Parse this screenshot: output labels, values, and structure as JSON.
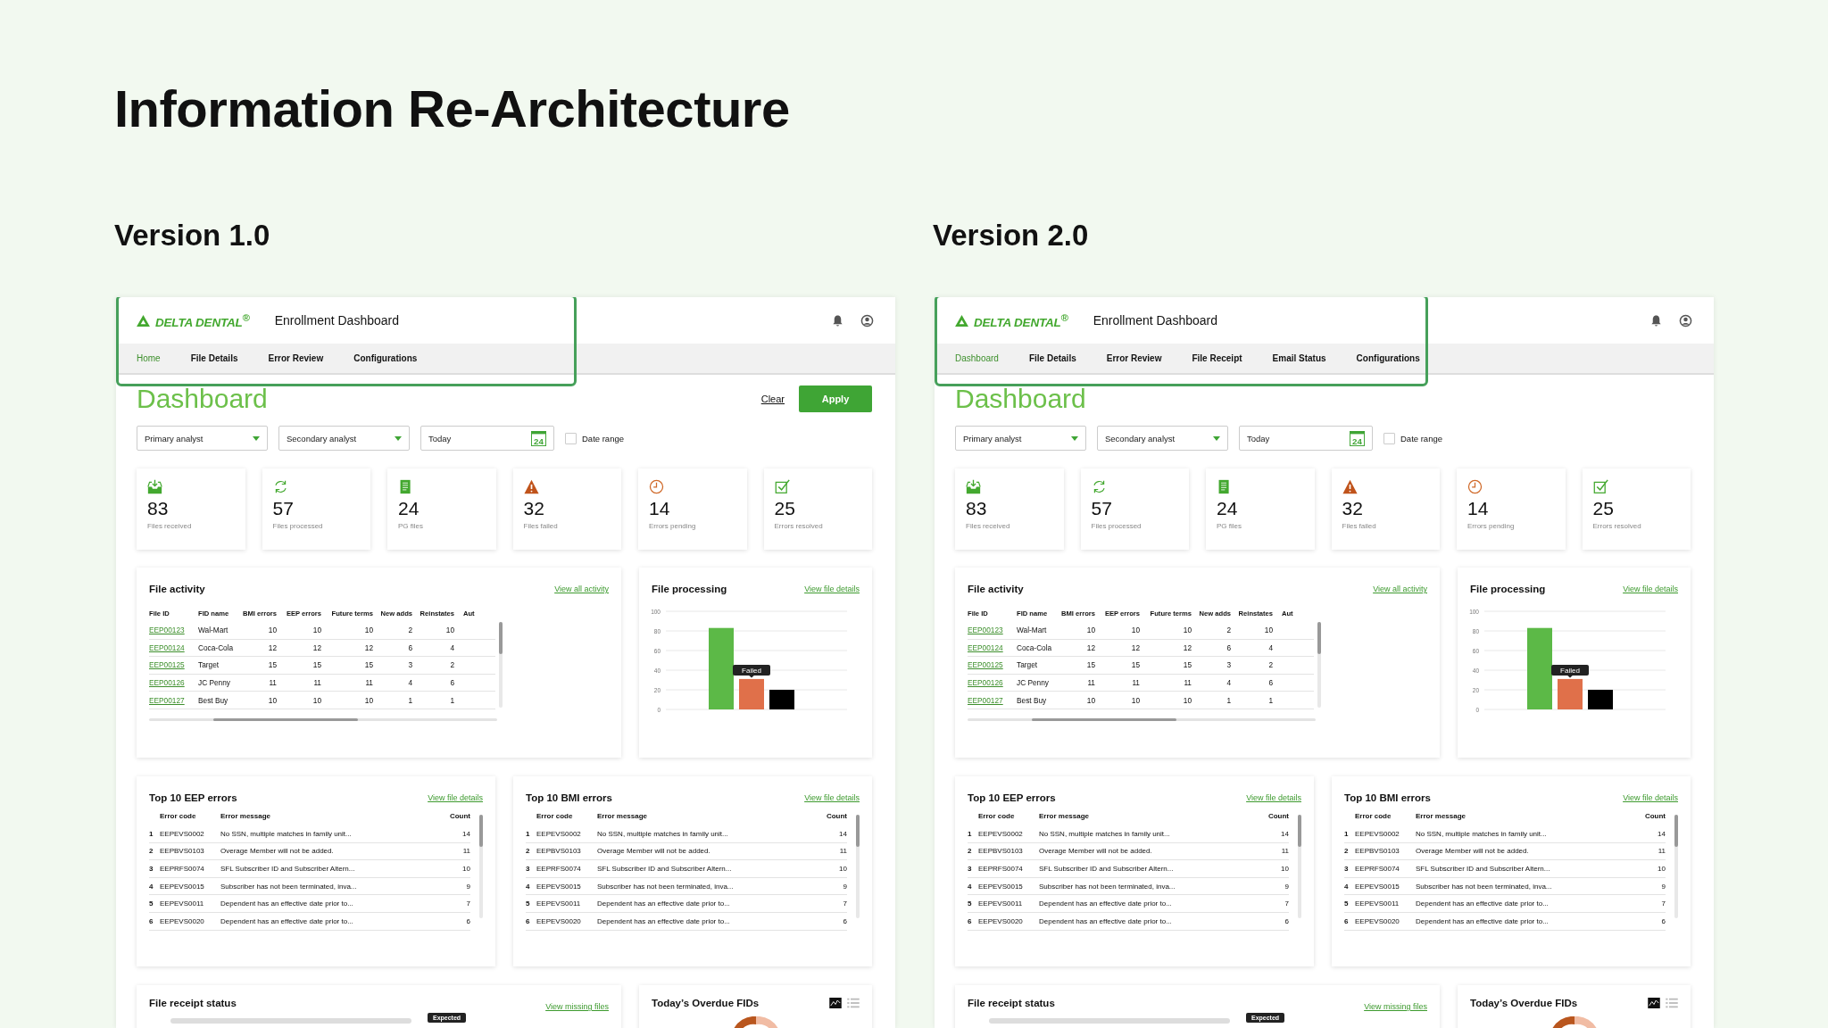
{
  "title": "Information Re-Architecture",
  "versions": [
    {
      "label": "Version 1.0",
      "app": {
        "brand": "DELTA DENTAL$^{®}$",
        "app_title": "Enrollment Dashboard",
        "nav": [
          {
            "label": "Home",
            "selected": true
          },
          {
            "label": "File Details",
            "selected": false
          },
          {
            "label": "Error Review",
            "selected": false
          },
          {
            "label": "Configurations",
            "selected": false
          }
        ],
        "page_title": "Dashboard",
        "clear": "Clear",
        "apply": "Apply",
        "filters": {
          "primary": "Primary analyst",
          "secondary": "Secondary analyst",
          "date": "Today",
          "calendar_day": "24",
          "date_range": {
            "label": "Date range",
            "checked": false
          }
        },
        "stats": [
          {
            "kind": "inbox",
            "value": "83",
            "label": "Files received"
          },
          {
            "kind": "sync",
            "value": "57",
            "label": "Files processed"
          },
          {
            "kind": "document",
            "value": "24",
            "label": "PG files"
          },
          {
            "kind": "warning",
            "value": "32",
            "label": "Files failed"
          },
          {
            "kind": "clock",
            "value": "14",
            "label": "Errors pending"
          },
          {
            "kind": "check",
            "value": "25",
            "label": "Errors resolved"
          }
        ],
        "file_activity": {
          "title": "File activity",
          "link": "View all activity",
          "columns": [
            "File ID",
            "FID name",
            "BMI errors",
            "EEP errors",
            "Future terms",
            "New adds",
            "Reinstates",
            "Aut"
          ],
          "rows": [
            [
              "EEP00123",
              "Wal-Mart",
              "10",
              "10",
              "10",
              "2",
              "10"
            ],
            [
              "EEP00124",
              "Coca-Cola",
              "12",
              "12",
              "12",
              "6",
              "4"
            ],
            [
              "EEP00125",
              "Target",
              "15",
              "15",
              "15",
              "3",
              "2"
            ],
            [
              "EEP00126",
              "JC Penny",
              "11",
              "11",
              "11",
              "4",
              "6"
            ],
            [
              "EEP00127",
              "Best Buy",
              "10",
              "10",
              "10",
              "1",
              "1"
            ]
          ]
        },
        "file_processing": {
          "title": "File processing",
          "link": "View file details",
          "chart_data": {
            "type": "bar",
            "ylim": [
              0,
              100
            ],
            "yticks": [
              0,
              20,
              40,
              60,
              80,
              100
            ],
            "grid": true,
            "series": [
              {
                "color": "#5cb947",
                "values": [
                  83
                ]
              },
              {
                "color": "#e0704a",
                "values": [
                  31
                ]
              },
              {
                "color": "#000000",
                "values": [
                  20
                ]
              }
            ],
            "annotations": [
              "Failed"
            ]
          }
        },
        "top_eep": {
          "title": "Top 10 EEP errors",
          "link": "View file details",
          "columns": [
            "Error code",
            "Error message",
            "Count"
          ],
          "rows": [
            {
              "rank": "1",
              "code": "EEPEVS0002",
              "message": "No SSN, multiple matches in family unit...",
              "count": "14"
            },
            {
              "rank": "2",
              "code": "EEPBVS0103",
              "message": "Overage Member will not be added.",
              "count": "11"
            },
            {
              "rank": "3",
              "code": "EEPRFS0074",
              "message": "SFL Subscriber ID and Subscriber Altern...",
              "count": "10"
            },
            {
              "rank": "4",
              "code": "EEPEVS0015",
              "message": "Subscriber has not been terminated, inva...",
              "count": "9"
            },
            {
              "rank": "5",
              "code": "EEPEVS0011",
              "message": "Dependent has an effective date prior to...",
              "count": "7"
            },
            {
              "rank": "6",
              "code": "EEPEVS0020",
              "message": "Dependent has an effective date prior to...",
              "count": "6"
            }
          ]
        },
        "top_bmi": {
          "title": "Top 10 BMI errors",
          "link": "View file details",
          "columns": [
            "Error code",
            "Error message",
            "Count"
          ],
          "rows": [
            {
              "rank": "1",
              "code": "EEPEVS0002",
              "message": "No SSN, multiple matches in family unit...",
              "count": "14"
            },
            {
              "rank": "2",
              "code": "EEPBVS0103",
              "message": "Overage Member will not be added.",
              "count": "11"
            },
            {
              "rank": "3",
              "code": "EEPRFS0074",
              "message": "SFL Subscriber ID and Subscriber Altern...",
              "count": "10"
            },
            {
              "rank": "4",
              "code": "EEPEVS0015",
              "message": "Subscriber has not been terminated, inva...",
              "count": "9"
            },
            {
              "rank": "5",
              "code": "EEPEVS0011",
              "message": "Dependent has an effective date prior to...",
              "count": "7"
            },
            {
              "rank": "6",
              "code": "EEPEVS0020",
              "message": "Dependent has an effective date prior to...",
              "count": "6"
            }
          ]
        },
        "file_receipt": {
          "title": "File receipt status",
          "link": "View missing files",
          "tooltip": "Expected"
        },
        "overdue": {
          "title": "Today’s Overdue FIDs"
        }
      }
    },
    {
      "label": "Version 2.0",
      "app": {
        "brand": "DELTA DENTAL$^{®}$",
        "app_title": "Enrollment Dashboard",
        "nav": [
          {
            "label": "Dashboard",
            "selected": true
          },
          {
            "label": "File Details",
            "selected": false
          },
          {
            "label": "Error Review",
            "selected": false
          },
          {
            "label": "File Receipt",
            "selected": false
          },
          {
            "label": "Email Status",
            "selected": false
          },
          {
            "label": "Configurations",
            "selected": false
          }
        ],
        "page_title": "Dashboard",
        "filters": {
          "primary": "Primary analyst",
          "secondary": "Secondary analyst",
          "date": "Today",
          "calendar_day": "24",
          "date_range": {
            "label": "Date range",
            "checked": false
          }
        },
        "stats": [
          {
            "kind": "inbox",
            "value": "83",
            "label": "Files received"
          },
          {
            "kind": "sync",
            "value": "57",
            "label": "Files processed"
          },
          {
            "kind": "document",
            "value": "24",
            "label": "PG files"
          },
          {
            "kind": "warning",
            "value": "32",
            "label": "Files failed"
          },
          {
            "kind": "clock",
            "value": "14",
            "label": "Errors pending"
          },
          {
            "kind": "check",
            "value": "25",
            "label": "Errors resolved"
          }
        ],
        "file_activity": {
          "title": "File activity",
          "link": "View all activity",
          "columns": [
            "File ID",
            "FID name",
            "BMI errors",
            "EEP errors",
            "Future terms",
            "New adds",
            "Reinstates",
            "Aut"
          ],
          "rows": [
            [
              "EEP00123",
              "Wal-Mart",
              "10",
              "10",
              "10",
              "2",
              "10"
            ],
            [
              "EEP00124",
              "Coca-Cola",
              "12",
              "12",
              "12",
              "6",
              "4"
            ],
            [
              "EEP00125",
              "Target",
              "15",
              "15",
              "15",
              "3",
              "2"
            ],
            [
              "EEP00126",
              "JC Penny",
              "11",
              "11",
              "11",
              "4",
              "6"
            ],
            [
              "EEP00127",
              "Best Buy",
              "10",
              "10",
              "10",
              "1",
              "1"
            ]
          ]
        },
        "file_processing": {
          "title": "File processing",
          "link": "View file details",
          "chart_data": {
            "type": "bar",
            "ylim": [
              0,
              100
            ],
            "yticks": [
              0,
              20,
              40,
              60,
              80,
              100
            ],
            "grid": true,
            "series": [
              {
                "color": "#5cb947",
                "values": [
                  83
                ]
              },
              {
                "color": "#e0704a",
                "values": [
                  31
                ]
              },
              {
                "color": "#000000",
                "values": [
                  20
                ]
              }
            ],
            "annotations": [
              "Failed"
            ]
          }
        },
        "top_eep": {
          "title": "Top 10 EEP errors",
          "link": "View file details",
          "columns": [
            "Error code",
            "Error message",
            "Count"
          ],
          "rows": [
            {
              "rank": "1",
              "code": "EEPEVS0002",
              "message": "No SSN, multiple matches in family unit...",
              "count": "14"
            },
            {
              "rank": "2",
              "code": "EEPBVS0103",
              "message": "Overage Member will not be added.",
              "count": "11"
            },
            {
              "rank": "3",
              "code": "EEPRFS0074",
              "message": "SFL Subscriber ID and Subscriber Altern...",
              "count": "10"
            },
            {
              "rank": "4",
              "code": "EEPEVS0015",
              "message": "Subscriber has not been terminated, inva...",
              "count": "9"
            },
            {
              "rank": "5",
              "code": "EEPEVS0011",
              "message": "Dependent has an effective date prior to...",
              "count": "7"
            },
            {
              "rank": "6",
              "code": "EEPEVS0020",
              "message": "Dependent has an effective date prior to...",
              "count": "6"
            }
          ]
        },
        "top_bmi": {
          "title": "Top 10 BMI errors",
          "link": "View file details",
          "columns": [
            "Error code",
            "Error message",
            "Count"
          ],
          "rows": [
            {
              "rank": "1",
              "code": "EEPEVS0002",
              "message": "No SSN, multiple matches in family unit...",
              "count": "14"
            },
            {
              "rank": "2",
              "code": "EEPBVS0103",
              "message": "Overage Member will not be added.",
              "count": "11"
            },
            {
              "rank": "3",
              "code": "EEPRFS0074",
              "message": "SFL Subscriber ID and Subscriber Altern...",
              "count": "10"
            },
            {
              "rank": "4",
              "code": "EEPEVS0015",
              "message": "Subscriber has not been terminated, inva...",
              "count": "9"
            },
            {
              "rank": "5",
              "code": "EEPEVS0011",
              "message": "Dependent has an effective date prior to...",
              "count": "7"
            },
            {
              "rank": "6",
              "code": "EEPEVS0020",
              "message": "Dependent has an effective date prior to...",
              "count": "6"
            }
          ]
        },
        "file_receipt": {
          "title": "File receipt status",
          "link": "View missing files",
          "tooltip": "Expected"
        },
        "overdue": {
          "title": "Today’s Overdue FIDs"
        }
      }
    }
  ]
}
